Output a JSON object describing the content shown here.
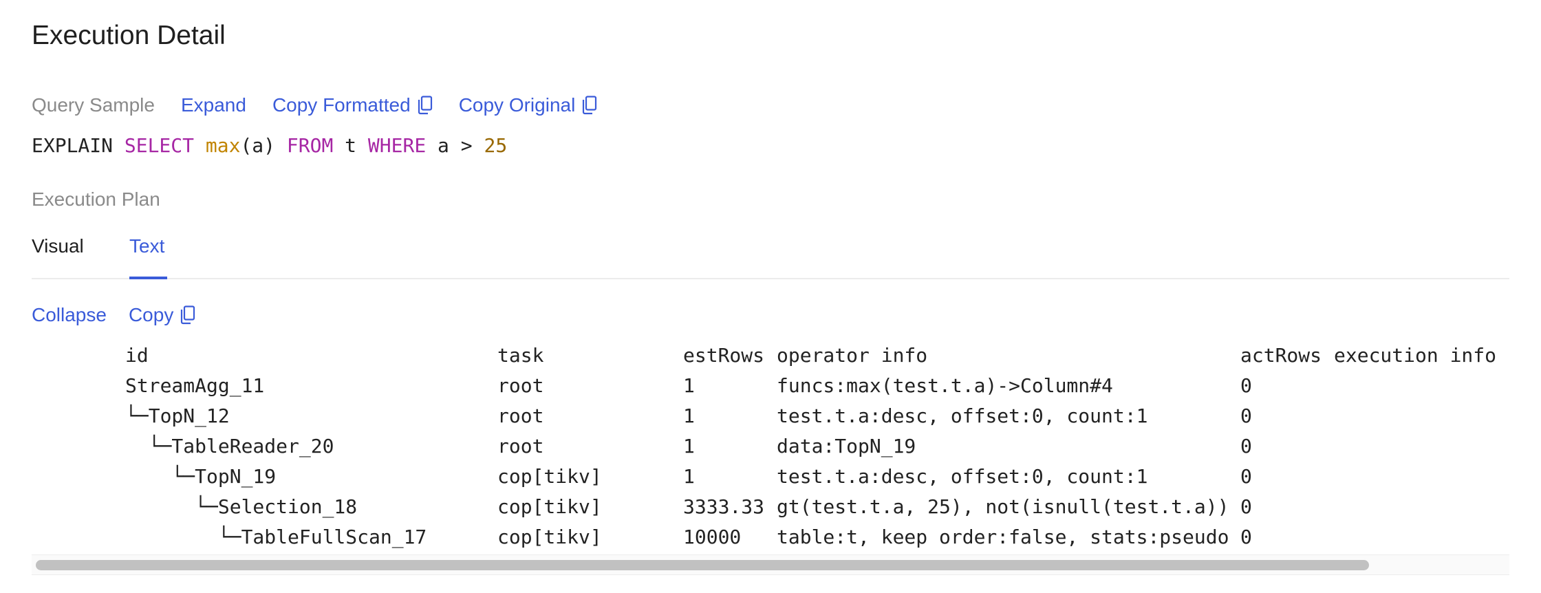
{
  "page": {
    "title": "Execution Detail"
  },
  "query_sample": {
    "label": "Query Sample",
    "expand_label": "Expand",
    "copy_formatted_label": "Copy Formatted",
    "copy_original_label": "Copy Original",
    "sql_tokens": [
      {
        "text": "EXPLAIN ",
        "kind": "plain"
      },
      {
        "text": "SELECT",
        "kind": "kw"
      },
      {
        "text": " ",
        "kind": "plain"
      },
      {
        "text": "max",
        "kind": "fn"
      },
      {
        "text": "(a) ",
        "kind": "plain"
      },
      {
        "text": "FROM",
        "kind": "kw"
      },
      {
        "text": " t ",
        "kind": "plain"
      },
      {
        "text": "WHERE",
        "kind": "kw"
      },
      {
        "text": " a > ",
        "kind": "plain"
      },
      {
        "text": "25",
        "kind": "num"
      }
    ]
  },
  "execution_plan": {
    "label": "Execution Plan",
    "tabs": [
      {
        "label": "Visual",
        "active": false
      },
      {
        "label": "Text",
        "active": true
      }
    ],
    "collapse_label": "Collapse",
    "copy_label": "Copy",
    "columns": [
      "id",
      "task",
      "estRows",
      "operator info",
      "actRows",
      "execution info"
    ],
    "rows": [
      [
        "StreamAgg_11",
        "root",
        "1",
        "funcs:max(test.t.a)->Column#4",
        "0",
        ""
      ],
      [
        "└─TopN_12",
        "root",
        "1",
        "test.t.a:desc, offset:0, count:1",
        "0",
        ""
      ],
      [
        "  └─TableReader_20",
        "root",
        "1",
        "data:TopN_19",
        "0",
        ""
      ],
      [
        "    └─TopN_19",
        "cop[tikv]",
        "1",
        "test.t.a:desc, offset:0, count:1",
        "0",
        ""
      ],
      [
        "      └─Selection_18",
        "cop[tikv]",
        "3333.33",
        "gt(test.t.a, 25), not(isnull(test.t.a))",
        "0",
        ""
      ],
      [
        "        └─TableFullScan_17",
        "cop[tikv]",
        "10000",
        "table:t, keep order:false, stats:pseudo",
        "0",
        ""
      ]
    ]
  },
  "colors": {
    "accent": "#3a5bd9",
    "muted": "#8a8a8a",
    "keyword": "#a626a4",
    "function": "#c18401",
    "number": "#986801"
  },
  "icons": {
    "copy": "copy-icon"
  }
}
